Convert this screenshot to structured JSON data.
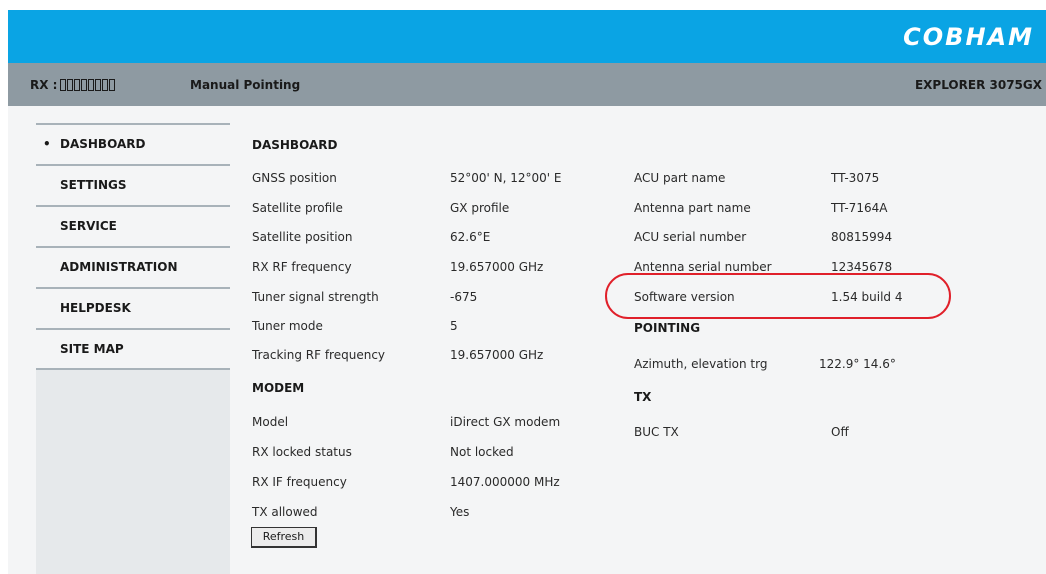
{
  "header": {
    "logo": "COBHAM"
  },
  "status": {
    "rx_label": "RX :",
    "mode": "Manual Pointing",
    "product": "EXPLORER 3075GX"
  },
  "sidebar": {
    "items": [
      {
        "label": "DASHBOARD",
        "active": true
      },
      {
        "label": "SETTINGS"
      },
      {
        "label": "SERVICE"
      },
      {
        "label": "ADMINISTRATION"
      },
      {
        "label": "HELPDESK"
      },
      {
        "label": "SITE MAP"
      }
    ]
  },
  "dashboard": {
    "title": "DASHBOARD",
    "rows": [
      {
        "label": "GNSS position",
        "value": "52°00' N, 12°00' E"
      },
      {
        "label": "Satellite profile",
        "value": "GX profile"
      },
      {
        "label": "Satellite position",
        "value": "62.6°E"
      },
      {
        "label": "RX RF frequency",
        "value": "19.657000 GHz"
      },
      {
        "label": "Tuner signal strength",
        "value": "-675"
      },
      {
        "label": "Tuner mode",
        "value": "5"
      },
      {
        "label": "Tracking RF frequency",
        "value": "19.657000 GHz"
      }
    ]
  },
  "modem": {
    "title": "MODEM",
    "rows": [
      {
        "label": "Model",
        "value": "iDirect GX modem"
      },
      {
        "label": "RX locked status",
        "value": "Not locked"
      },
      {
        "label": "RX IF frequency",
        "value": "1407.000000 MHz"
      },
      {
        "label": "TX allowed",
        "value": "Yes"
      }
    ],
    "refresh_label": "Refresh"
  },
  "info": {
    "rows": [
      {
        "label": "ACU part name",
        "value": "TT-3075"
      },
      {
        "label": "Antenna part name",
        "value": "TT-7164A"
      },
      {
        "label": "ACU serial number",
        "value": "80815994"
      },
      {
        "label": "Antenna serial number",
        "value": "12345678"
      },
      {
        "label": "Software version",
        "value": "1.54 build 4"
      }
    ]
  },
  "pointing": {
    "title": "POINTING",
    "rows": [
      {
        "label": "Azimuth, elevation trg",
        "value": "122.9° 14.6°"
      }
    ]
  },
  "tx": {
    "title": "TX",
    "rows": [
      {
        "label": "BUC TX",
        "value": "Off"
      }
    ]
  },
  "colors": {
    "topbar": "#0aa4e4",
    "statusbar": "#8e9aa2",
    "highlight": "#e0202a"
  }
}
